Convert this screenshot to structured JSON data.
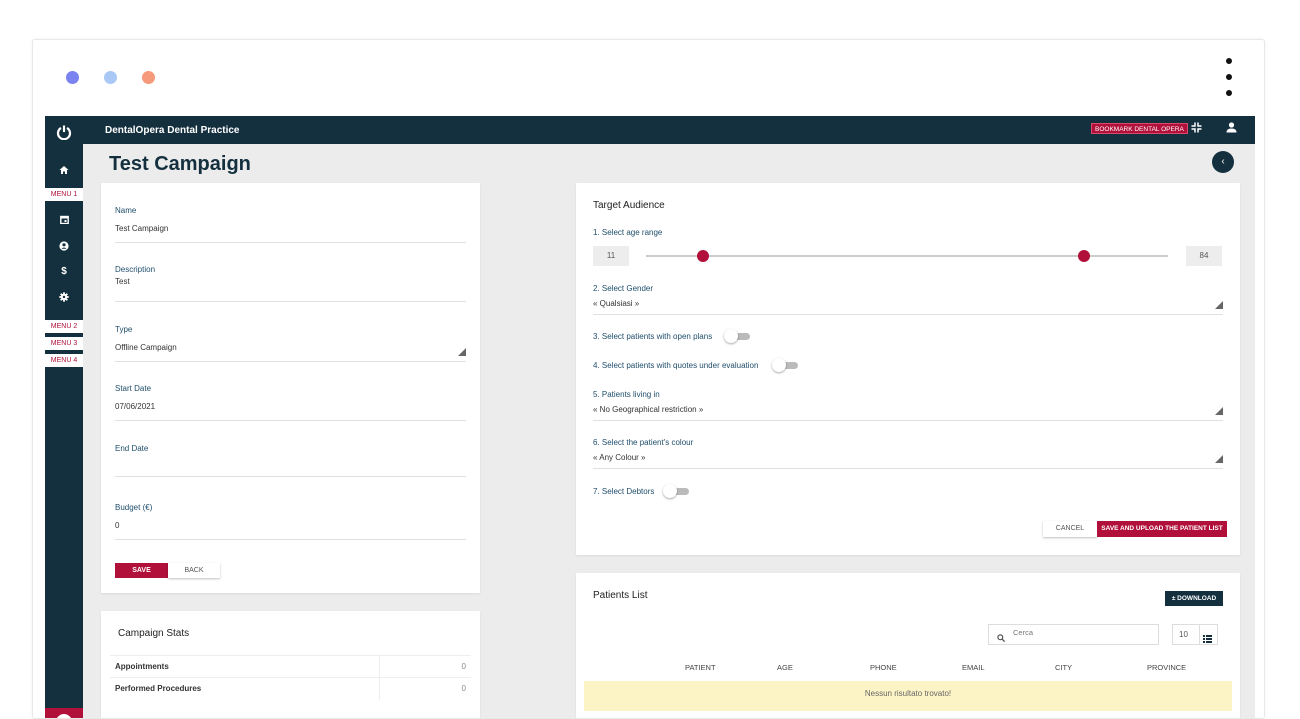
{
  "window": {
    "dot_colors": [
      "#7b83f0",
      "#aac8f5",
      "#f59a7a"
    ]
  },
  "topbar": {
    "practice_name": "DentalOpera Dental Practice",
    "bookmark_label": "BOOKMARK DENTAL OPERA",
    "icons": [
      "compress-icon",
      "user-icon"
    ]
  },
  "sidebar": {
    "menus": [
      "MENU 1",
      "MENU 2",
      "MENU 3",
      "MENU 4"
    ],
    "icons": [
      "power-icon",
      "home-icon",
      "calendar-icon",
      "account-icon",
      "dollar-icon",
      "settings-icon"
    ]
  },
  "page": {
    "title": "Test Campaign"
  },
  "campaign_form": {
    "name_label": "Name",
    "name_value": "Test Campaign",
    "description_label": "Description",
    "description_value": "Test",
    "type_label": "Type",
    "type_value": "Offline Campaign",
    "start_label": "Start Date",
    "start_value": "07/06/2021",
    "end_label": "End Date",
    "end_value": "",
    "budget_label": "Budget (€)",
    "budget_value": "0",
    "save_label": "SAVE",
    "back_label": "BACK"
  },
  "stats": {
    "title": "Campaign Stats",
    "rows": [
      {
        "label": "Appointments",
        "value": "0"
      },
      {
        "label": "Performed Procedures",
        "value": "0"
      }
    ]
  },
  "target": {
    "title": "Target Audience",
    "age_label": "1. Select age range",
    "age_min": "11",
    "age_max": "84",
    "age_slider_min": 11,
    "age_slider_max": 84,
    "age_range": [
      0,
      100
    ],
    "gender_label": "2. Select Gender",
    "gender_value": "« Qualsiasi »",
    "open_plans_label": "3. Select patients with open plans",
    "quotes_label": "4. Select patients with quotes under evaluation",
    "living_label": "5. Patients living in",
    "living_value": "« No Geographical restriction »",
    "colour_label": "6. Select the patient's colour",
    "colour_value": "« Any Colour »",
    "debtors_label": "7. Select Debtors",
    "cancel_label": "CANCEL",
    "save_upload_label": "SAVE AND UPLOAD THE PATIENT LIST",
    "accent_color": "#b0103a"
  },
  "patients": {
    "title": "Patients List",
    "download_label": "± DOWNLOAD",
    "search_placeholder": "Cerca",
    "page_size": "10",
    "columns": [
      "PATIENT",
      "AGE",
      "PHONE",
      "EMAIL",
      "CITY",
      "PROVINCE"
    ],
    "empty_message": "Nessun risultato trovato!"
  }
}
